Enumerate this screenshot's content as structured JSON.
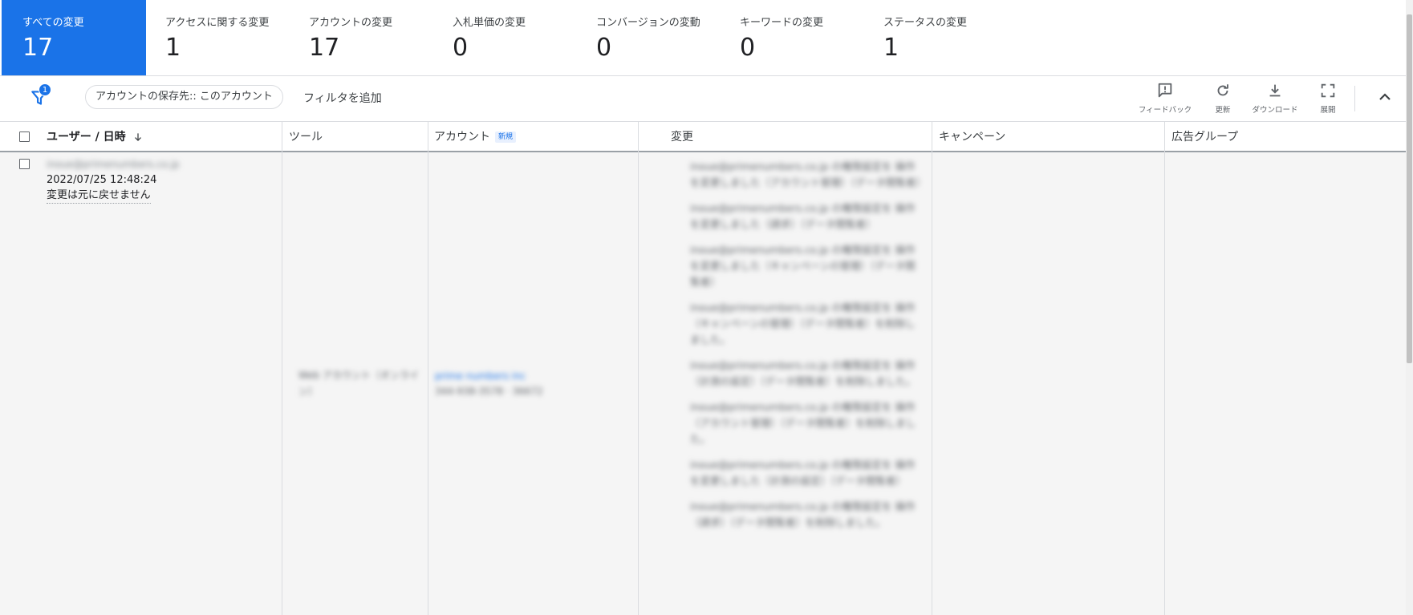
{
  "summary_tabs": [
    {
      "label": "すべての変更",
      "count": "17"
    },
    {
      "label": "アクセスに関する変更",
      "count": "1"
    },
    {
      "label": "アカウントの変更",
      "count": "17"
    },
    {
      "label": "入札単価の変更",
      "count": "0"
    },
    {
      "label": "コンバージョンの変動",
      "count": "0"
    },
    {
      "label": "キーワードの変更",
      "count": "0"
    },
    {
      "label": "ステータスの変更",
      "count": "1"
    }
  ],
  "toolbar": {
    "filter_badge": "1",
    "filter_chip": "アカウントの保存先:: このアカウント",
    "add_filter": "フィルタを追加",
    "feedback_label": "フィードバック",
    "refresh_label": "更新",
    "download_label": "ダウンロード",
    "expand_label": "展開"
  },
  "table": {
    "headers": {
      "user_date": "ユーザー / 日時",
      "tool": "ツール",
      "account": "アカウント",
      "account_badge": "新規",
      "change": "変更",
      "campaign": "キャンペーン",
      "ad_group": "広告グループ"
    },
    "row": {
      "user_email": "inoue@primenumbers.co.jp",
      "datetime": "2022/07/25 12:48:24",
      "note": "変更は元に戻せません",
      "tool": "Web アカウント（オンライン）",
      "account_name": "prime numbers inc",
      "account_id": "344-938-3578 · 36672",
      "changes": [
        "inoue@primenumbers.co.jp の権限設定を 操作を変更しました（アカウント管理）（データ閲覧者）",
        "inoue@primenumbers.co.jp の権限設定を 操作を変更しました（請求）（データ閲覧者）",
        "inoue@primenumbers.co.jp の権限設定を 操作を変更しました（キャンペーンの管理）（データ閲覧者）",
        "inoue@primenumbers.co.jp の権限設定を 操作（キャンペーンの管理）（データ閲覧者）を削除しました。",
        "inoue@primenumbers.co.jp の権限設定を 操作（計測の設定）（データ閲覧者）を削除しました。",
        "inoue@primenumbers.co.jp の権限設定を 操作（アカウント管理）（データ閲覧者）を削除しました。",
        "inoue@primenumbers.co.jp の権限設定を 操作を変更しました（計測の設定）（データ閲覧者）",
        "inoue@primenumbers.co.jp の権限設定を 操作（請求）（データ閲覧者）を削除しました。"
      ]
    }
  }
}
